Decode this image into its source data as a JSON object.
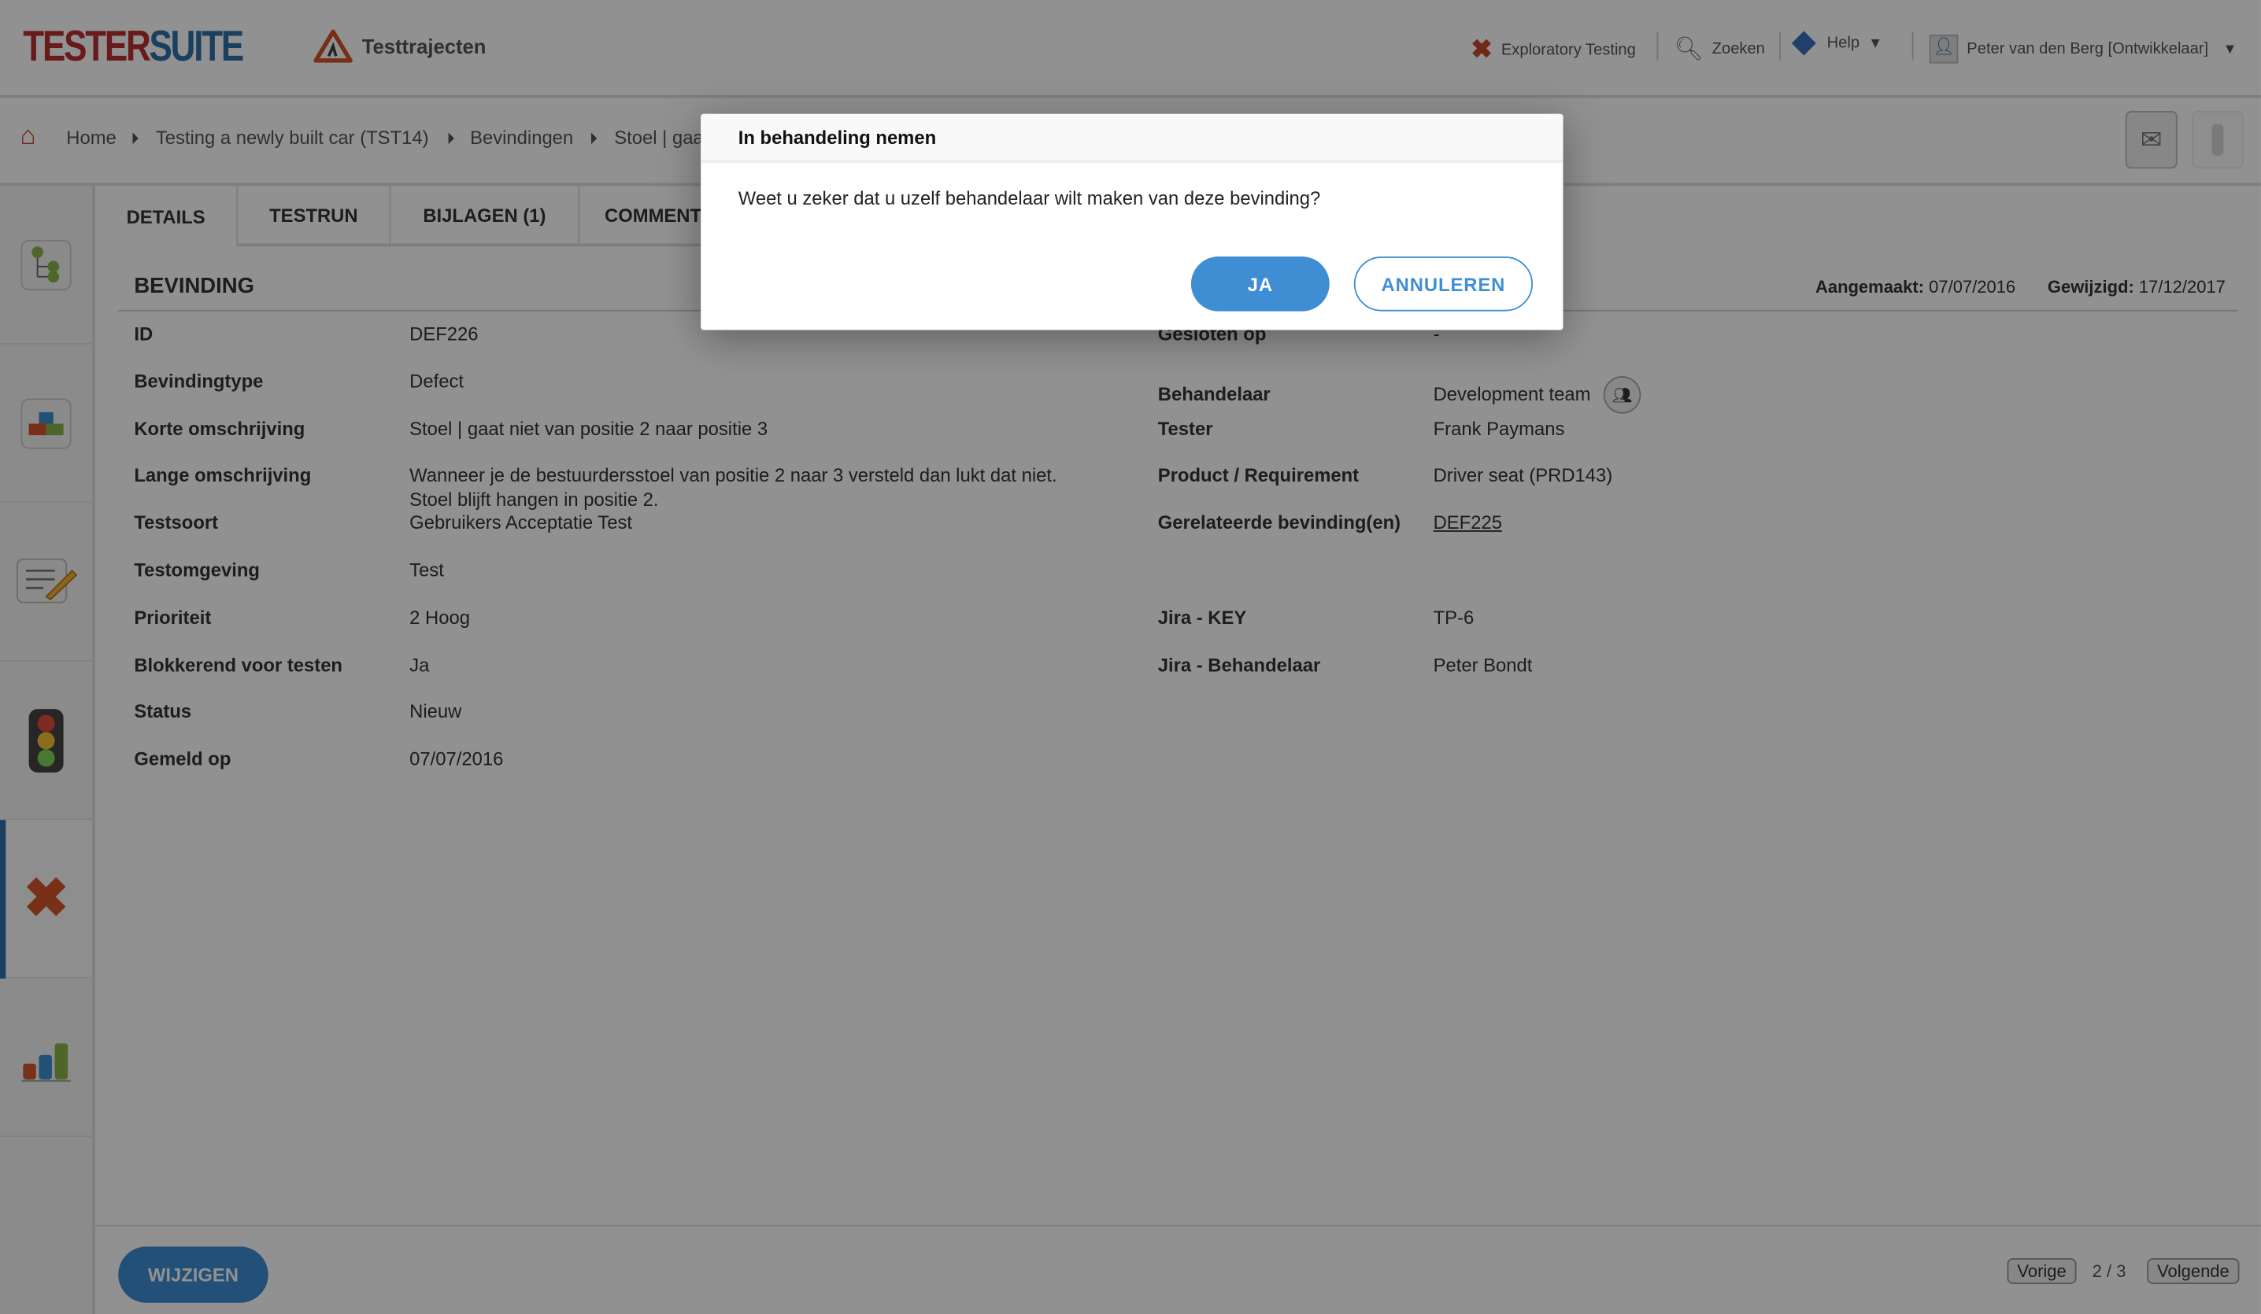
{
  "header": {
    "logo_part1": "TESTER",
    "logo_part2": "SUITE",
    "module": "Testtrajecten",
    "nav": [
      {
        "label": "Exploratory Testing",
        "icon": "red-x-icon"
      },
      {
        "label": "Zoeken",
        "icon": "magnifier-icon"
      },
      {
        "label": "Help",
        "icon": "help-diamond-icon"
      },
      {
        "label": "Peter van den Berg [Ontwikkelaar]",
        "icon": "user-icon"
      }
    ]
  },
  "breadcrumb": [
    "Home",
    "Testing a newly built car (TST14)",
    "Bevindingen",
    "Stoel | gaat niet van positie 2 naar positie 3"
  ],
  "sidebar": {
    "items": [
      "tree-icon",
      "blocks-icon",
      "edit-document-icon",
      "traffic-light-icon",
      "red-x-icon",
      "bar-chart-icon"
    ],
    "active_index": 4
  },
  "tabs": [
    "DETAILS",
    "TESTRUN",
    "BIJLAGEN (1)",
    "COMMENTAAR"
  ],
  "section": {
    "title": "BEVINDING",
    "created_label": "Aangemaakt:",
    "created": "07/07/2016",
    "modified_label": "Gewijzigd:",
    "modified": "17/12/2017"
  },
  "left_fields": [
    {
      "label": "ID",
      "value": "DEF226"
    },
    {
      "label": "Bevindingtype",
      "value": "Defect"
    },
    {
      "label": "Korte omschrijving",
      "value": "Stoel | gaat niet van positie 2 naar positie 3"
    },
    {
      "label": "Lange omschrijving",
      "value": "Wanneer je de bestuurdersstoel van positie 2 naar 3 versteld dan lukt dat niet.",
      "value2": "Stoel blijft hangen in positie 2."
    },
    {
      "label": "Testsoort",
      "value": "Gebruikers Acceptatie Test"
    },
    {
      "label": "Testomgeving",
      "value": "Test"
    },
    {
      "label": "Prioriteit",
      "value": "2 Hoog"
    },
    {
      "label": "Blokkerend voor testen",
      "value": "Ja"
    },
    {
      "label": "Status",
      "value": "Nieuw"
    },
    {
      "label": "Gemeld op",
      "value": "07/07/2016"
    }
  ],
  "right_fields": [
    {
      "label": "Gesloten op",
      "value": "-"
    },
    {
      "label": "Behandelaar",
      "value": "Development team"
    },
    {
      "label": "Tester",
      "value": "Frank Paymans"
    },
    {
      "label": "Product / Requirement",
      "value": "Driver seat (PRD143)"
    },
    {
      "label": "Gerelateerde bevinding(en)",
      "value": "DEF225"
    },
    {
      "label": "Jira - KEY",
      "value": "TP-6"
    },
    {
      "label": "Jira - Behandelaar",
      "value": "Peter Bondt"
    }
  ],
  "footer": {
    "edit": "WIJZIGEN",
    "prev": "Vorige",
    "page": "2 / 3",
    "next": "Volgende"
  },
  "dialog": {
    "title": "In behandeling nemen",
    "message": "Weet u zeker dat u uzelf behandelaar wilt maken van deze bevinding?",
    "confirm": "JA",
    "cancel": "ANNULEREN"
  },
  "colors": {
    "accent": "#3f8ed4",
    "logo_red": "#b8302f",
    "logo_blue": "#2f6fa8"
  }
}
